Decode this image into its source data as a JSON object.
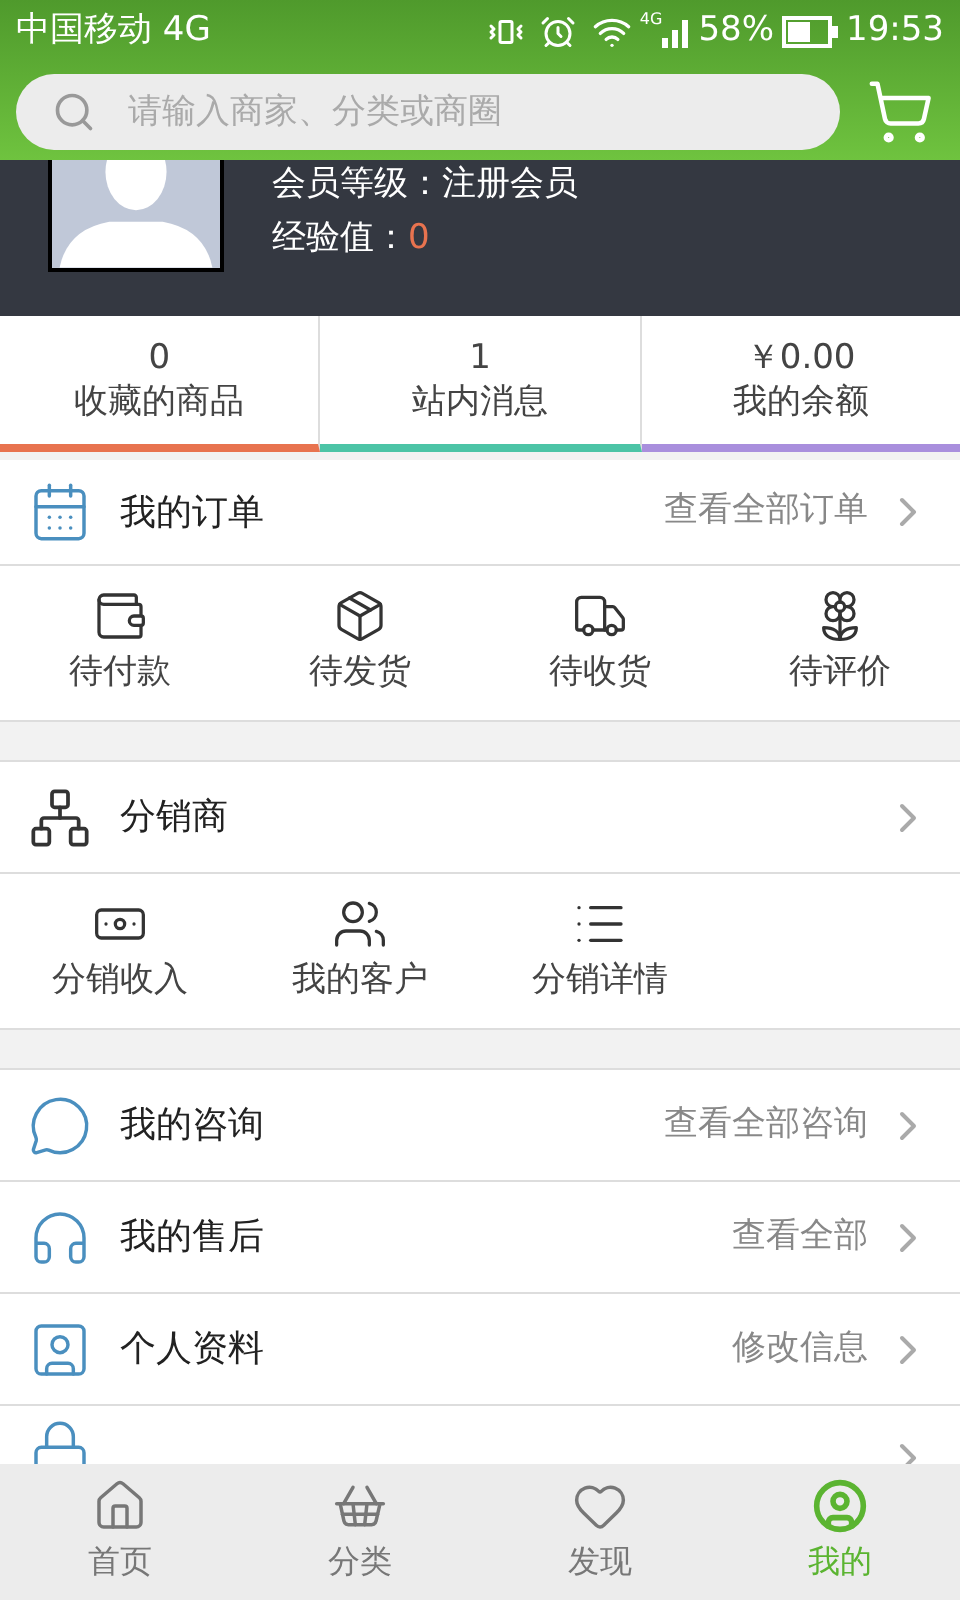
{
  "status_bar": {
    "carrier": "中国移动 4G",
    "network_type": "4G",
    "battery": "58%",
    "time": "19:53"
  },
  "search": {
    "placeholder": "请输入商家、分类或商圈"
  },
  "profile": {
    "level_label": "会员等级：",
    "level": "注册会员",
    "exp_label": "经验值：",
    "exp": "0"
  },
  "stats": [
    {
      "value": "0",
      "label": "收藏的商品",
      "color": "#e8734f"
    },
    {
      "value": "1",
      "label": "站内消息",
      "color": "#4cc4a6"
    },
    {
      "value": "￥0.00",
      "label": "我的余额",
      "color": "#a98fdd"
    }
  ],
  "orders": {
    "title": "我的订单",
    "link": "查看全部订单",
    "items": [
      "待付款",
      "待发货",
      "待收货",
      "待评价"
    ]
  },
  "distributor": {
    "title": "分销商",
    "items": [
      "分销收入",
      "我的客户",
      "分销详情"
    ]
  },
  "rows": [
    {
      "title": "我的咨询",
      "link": "查看全部咨询"
    },
    {
      "title": "我的售后",
      "link": "查看全部"
    },
    {
      "title": "个人资料",
      "link": "修改信息"
    }
  ],
  "tabs": [
    {
      "label": "首页",
      "selected": false
    },
    {
      "label": "分类",
      "selected": false
    },
    {
      "label": "发现",
      "selected": false
    },
    {
      "label": "我的",
      "selected": true
    }
  ]
}
